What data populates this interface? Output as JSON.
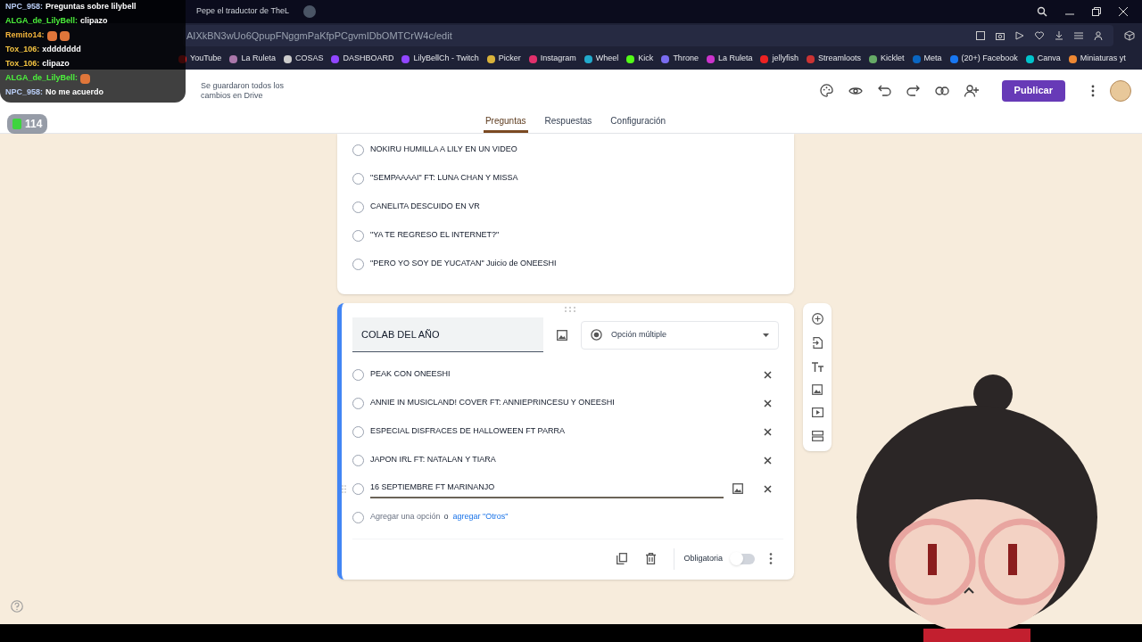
{
  "stream_chat": {
    "messages": [
      {
        "user": "NPC_958:",
        "color": "#b9cdf5",
        "text": "Preguntas sobre lilybell"
      },
      {
        "user": "ALGA_de_LilyBell:",
        "color": "#4cf03c",
        "text": "clipazo"
      },
      {
        "user": "Remito14:",
        "color": "#f2b43c",
        "emotes": [
          {
            "kind": "image"
          },
          {
            "kind": "image"
          }
        ]
      },
      {
        "user": "Tox_106:",
        "color": "#f5c542",
        "text": "xddddddd"
      },
      {
        "user": "Tox_106:",
        "color": "#f5c542",
        "text": "clipazo"
      },
      {
        "user": "ALGA_de_LilyBell:",
        "color": "#4cf03c",
        "emotes": [
          {
            "kind": "image"
          }
        ]
      },
      {
        "user": "NPC_958:",
        "color": "#b9cdf5",
        "text": "No me acuerdo"
      }
    ]
  },
  "viewer_count": "114",
  "browser": {
    "tabs": [
      {
        "label": "Pepe el traductor de TheL",
        "selected": false
      }
    ],
    "url": "AIXkBN3wUo6QpupFNggmPaKfpPCgvmIDbOMTCrW4c/edit",
    "bookmarks": [
      "YouTube",
      "La Ruleta",
      "COSAS",
      "DASHBOARD",
      "LilyBellCh - Twitch",
      "Picker",
      "Instagram",
      "Wheel",
      "Kick",
      "Throne",
      "La Ruleta",
      "jellyfish",
      "Streamloots",
      "Kicklet",
      "Meta",
      "(20+) Facebook",
      "Canva",
      "Miniaturas yt"
    ]
  },
  "forms_header": {
    "save_status": "Se guardaron todos los cambios en Drive",
    "publish_button": "Publicar",
    "tabs": [
      {
        "label": "Preguntas",
        "selected": true
      },
      {
        "label": "Respuestas",
        "selected": false
      },
      {
        "label": "Configuración",
        "selected": false
      }
    ]
  },
  "previous_question": {
    "options": [
      {
        "text": "NOKIRU HUMILLA A LILY EN UN VIDEO",
        "selected": false
      },
      {
        "text": "\"SEMPAAAAI\" FT: LUNA CHAN Y MISSA",
        "selected": false
      },
      {
        "text": "CANELITA DESCUIDO EN VR",
        "selected": false
      },
      {
        "text": "\"YA TE REGRESO EL INTERNET?\"",
        "selected": false
      },
      {
        "text": "\"PERO YO SOY DE YUCATAN\" Juicio de ONEESHI",
        "selected": false
      }
    ]
  },
  "question": {
    "title": "COLAB DEL AÑO",
    "type": "Opción múltiple",
    "options": [
      {
        "text": "PEAK CON ONEESHI",
        "editing": false,
        "selected": false
      },
      {
        "text": "ANNIE IN MUSICLAND! COVER FT: ANNIEPRINCESU Y ONEESHI",
        "editing": false,
        "selected": false
      },
      {
        "text": "ESPECIAL DISFRACES DE HALLOWEEN FT PARRA",
        "editing": false,
        "selected": false
      },
      {
        "text": "JAPON IRL FT: NATALAN Y TIARA",
        "editing": false,
        "selected": false
      },
      {
        "text": "16 SEPTIEMBRE FT MARINANJO",
        "editing": true,
        "selected": false
      }
    ],
    "add_option": "Agregar una opción",
    "or": "o",
    "add_other": "agregar \"Otros\"",
    "required_label": "Obligatoria",
    "required": false
  }
}
